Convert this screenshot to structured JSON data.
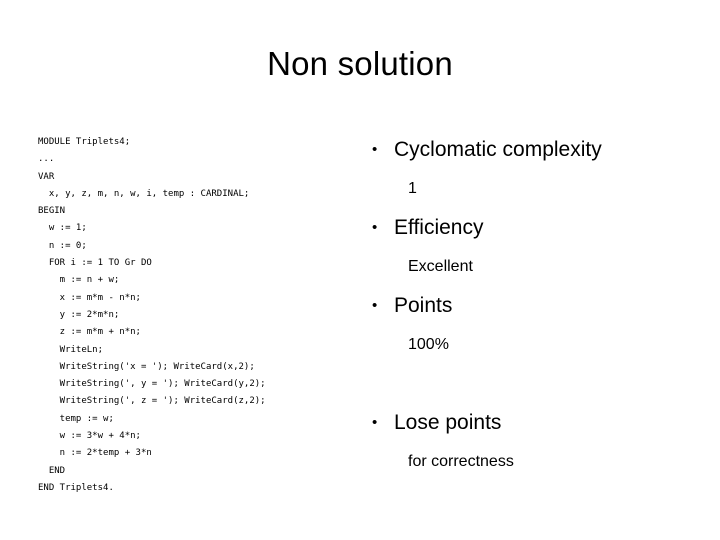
{
  "slide": {
    "title": "Non solution",
    "background_color": "#ffffff",
    "text_color": "#000000"
  },
  "code_panel": {
    "language": "Modula-2",
    "lines": [
      "MODULE Triplets4;",
      "...",
      "VAR",
      "  x, y, z, m, n, w, i, temp : CARDINAL;",
      "BEGIN",
      "  w := 1;",
      "  n := 0;",
      "  FOR i := 1 TO Gr DO",
      "    m := n + w;",
      "    x := m*m - n*n;",
      "    y := 2*m*n;",
      "    z := m*m + n*n;",
      "    WriteLn;",
      "    WriteString('x = '); WriteCard(x,2);",
      "    WriteString(', y = '); WriteCard(y,2);",
      "    WriteString(', z = '); WriteCard(z,2);",
      "    temp := w;",
      "    w := 3*w + 4*n;",
      "    n := 2*temp + 3*n",
      "  END",
      "END Triplets4."
    ]
  },
  "bullet_panel": {
    "bullet_glyph": "•",
    "items": [
      {
        "level": 0,
        "label": "Cyclomatic complexity",
        "bulleted": true
      },
      {
        "level": 1,
        "label": "1",
        "bulleted": false
      },
      {
        "level": 0,
        "label": "Efficiency",
        "bulleted": true
      },
      {
        "level": 1,
        "label": "Excellent",
        "bulleted": false
      },
      {
        "level": 0,
        "label": "Points",
        "bulleted": true
      },
      {
        "level": 1,
        "label": "100%",
        "bulleted": false
      },
      {
        "level": 1,
        "label": "",
        "bulleted": false,
        "spacer": true
      },
      {
        "level": 0,
        "label": "Lose points",
        "bulleted": true
      },
      {
        "level": 1,
        "label": "for correctness",
        "bulleted": false
      }
    ]
  }
}
